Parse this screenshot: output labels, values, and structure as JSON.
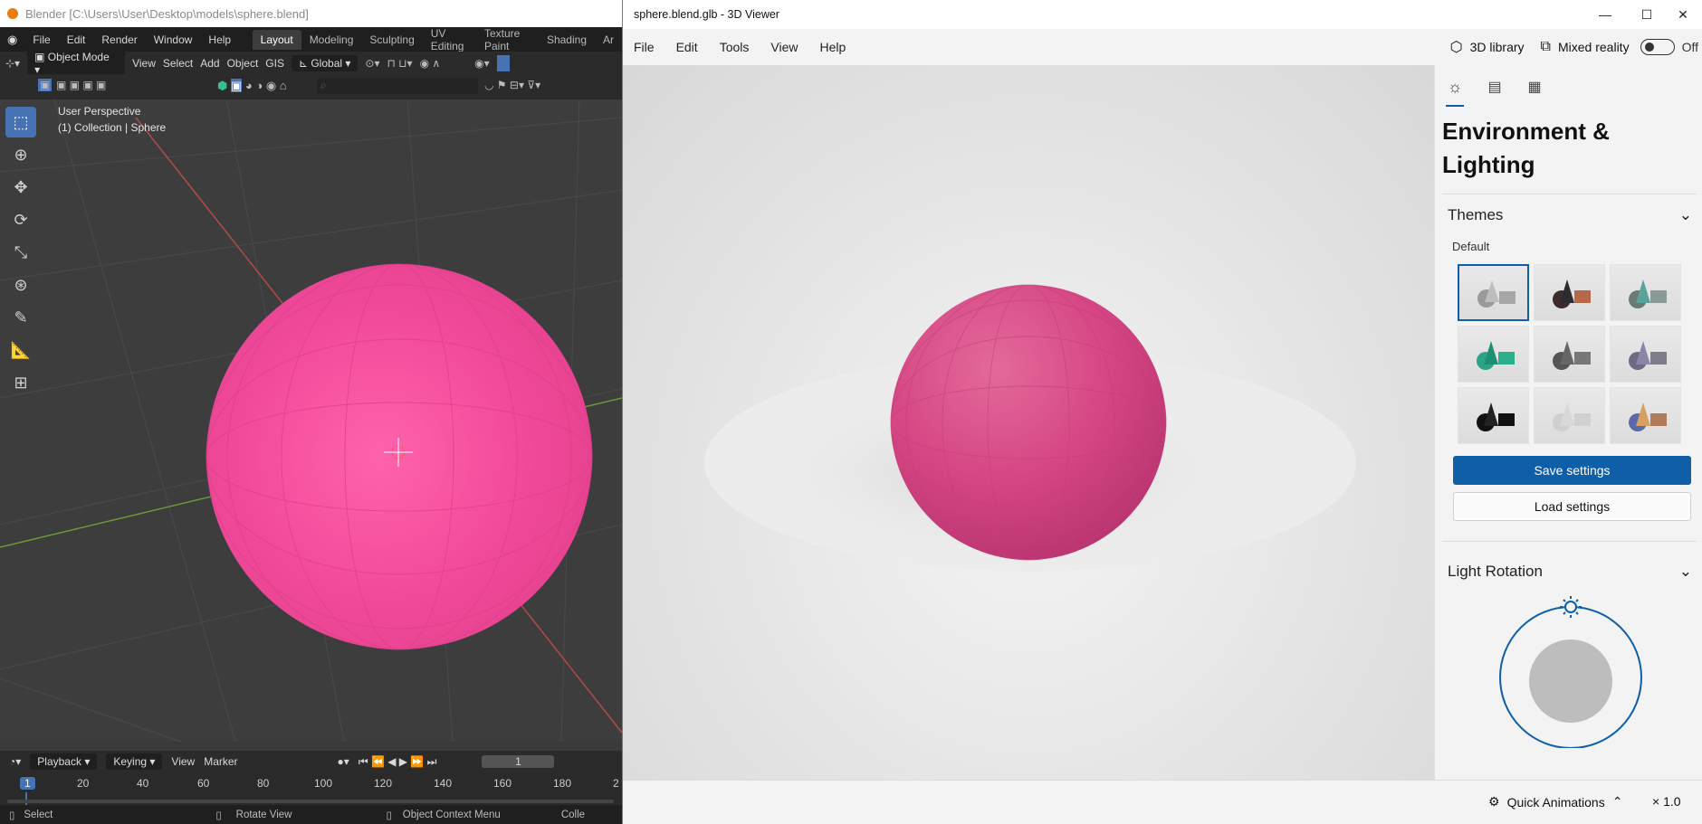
{
  "blender": {
    "title": "Blender [C:\\Users\\User\\Desktop\\models\\sphere.blend]",
    "menu": [
      "File",
      "Edit",
      "Render",
      "Window",
      "Help"
    ],
    "workspaces": [
      "Layout",
      "Modeling",
      "Sculpting",
      "UV Editing",
      "Texture Paint",
      "Shading",
      "Ar"
    ],
    "header": {
      "mode": "Object Mode",
      "menus": [
        "View",
        "Select",
        "Add",
        "Object",
        "GIS"
      ],
      "transform": "Global"
    },
    "viewport": {
      "perspective": "User Perspective",
      "collection": "(1) Collection | Sphere"
    },
    "timeline": {
      "menus": [
        "Playback",
        "Keying",
        "View",
        "Marker"
      ],
      "current_frame": "1",
      "frame_labels": [
        "1",
        "20",
        "40",
        "60",
        "80",
        "100",
        "120",
        "140",
        "160",
        "180",
        "2"
      ]
    },
    "status": [
      "Select",
      "Rotate View",
      "Object Context Menu",
      "Colle"
    ],
    "colors": {
      "sphere": "#f0489a",
      "accent": "#4772b3"
    }
  },
  "viewer": {
    "title": "sphere.blend.glb - 3D Viewer",
    "menu": [
      "File",
      "Edit",
      "Tools",
      "View",
      "Help"
    ],
    "library_label": "3D library",
    "mixed_reality_label": "Mixed reality",
    "toggle_state": "Off",
    "panel": {
      "heading_line1": "Environment &",
      "heading_line2": "Lighting",
      "themes_label": "Themes",
      "default_label": "Default",
      "save_label": "Save settings",
      "load_label": "Load settings",
      "light_rotation_label": "Light Rotation"
    },
    "bottom": {
      "quick_animations_label": "Quick Animations",
      "speed_label": "× 1.0"
    },
    "colors": {
      "sphere": "#d9447f",
      "accent": "#0f5fa8"
    }
  }
}
